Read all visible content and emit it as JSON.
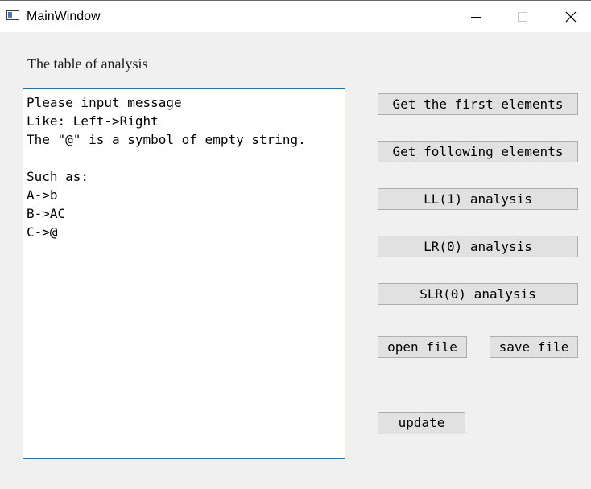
{
  "window": {
    "title": "MainWindow",
    "icons": {
      "app": "app-window-icon",
      "minimize": "minimize-icon",
      "maximize": "maximize-icon",
      "close": "close-icon"
    }
  },
  "main": {
    "caption": "The table of analysis",
    "editor_text": "Please input message\nLike: Left->Right\nThe \"@\" is a symbol of empty string.\n\nSuch as:\nA->b\nB->AC\nC->@"
  },
  "buttons": {
    "first": "Get the first elements",
    "following": "Get following elements",
    "ll1": "LL(1) analysis",
    "lr0": "LR(0) analysis",
    "slr0": "SLR(0) analysis",
    "open": "open file",
    "save": "save file",
    "update": "update"
  },
  "colors": {
    "focus_border": "#0078d7",
    "button_bg": "#e1e1e1",
    "button_border": "#adadad",
    "window_bg": "#f0f0f0"
  }
}
